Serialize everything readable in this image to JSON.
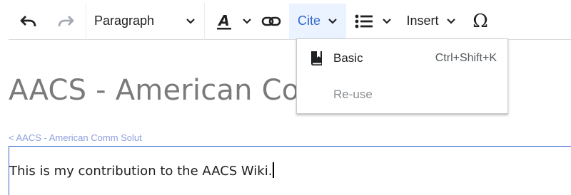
{
  "toolbar": {
    "undo_icon": "undo-icon",
    "redo_icon": "redo-icon",
    "paragraph_label": "Paragraph",
    "text_style_icon": "text-style-icon",
    "link_icon": "link-icon",
    "cite_label": "Cite",
    "list_icon": "bullet-list-icon",
    "insert_label": "Insert",
    "special_char_label": "Ω"
  },
  "cite_menu": {
    "items": [
      {
        "label": "Basic",
        "shortcut": "Ctrl+Shift+K",
        "icon": "book-icon"
      },
      {
        "label": "Re-use",
        "shortcut": "",
        "icon": ""
      }
    ]
  },
  "page": {
    "title": "AACS - American Comm Solut Wiki",
    "backlink": "< AACS - American Comm Solut",
    "body_text": "This is my contribution to the AACS Wiki."
  },
  "colors": {
    "accent": "#3366cc",
    "cite_active_bg": "#eaf3ff",
    "title_gray": "#7a7a7a",
    "backlink": "#8fa0dd"
  }
}
